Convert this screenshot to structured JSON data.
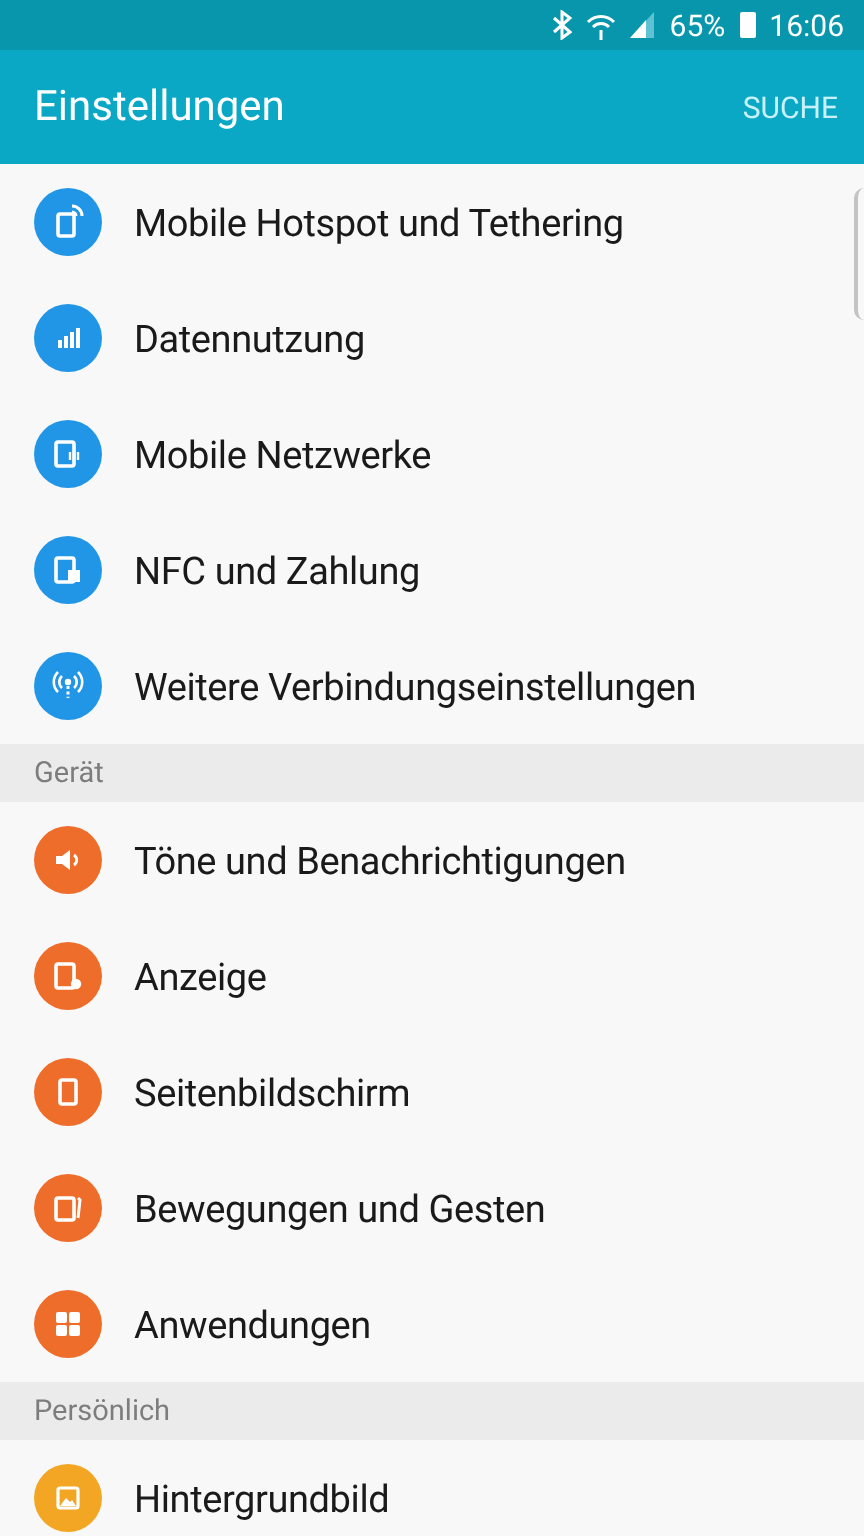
{
  "status_bar": {
    "battery": "65%",
    "time": "16:06"
  },
  "app_bar": {
    "title": "Einstellungen",
    "action": "SUCHE"
  },
  "sections": [
    {
      "items": [
        {
          "label": "Mobile Hotspot und Tethering",
          "color": "#2196e6"
        },
        {
          "label": "Datennutzung",
          "color": "#2196e6"
        },
        {
          "label": "Mobile Netzwerke",
          "color": "#2196e6"
        },
        {
          "label": "NFC und Zahlung",
          "color": "#2196e6"
        },
        {
          "label": "Weitere Verbindungseinstellungen",
          "color": "#2196e6"
        }
      ]
    },
    {
      "header": "Gerät",
      "items": [
        {
          "label": "Töne und Benachrichtigungen",
          "color": "#ee6d2a"
        },
        {
          "label": "Anzeige",
          "color": "#ee6d2a"
        },
        {
          "label": "Seitenbildschirm",
          "color": "#ee6d2a"
        },
        {
          "label": "Bewegungen und Gesten",
          "color": "#ee6d2a"
        },
        {
          "label": "Anwendungen",
          "color": "#ee6d2a"
        }
      ]
    },
    {
      "header": "Persönlich",
      "items": [
        {
          "label": "Hintergrundbild",
          "color": "#f2a623"
        }
      ]
    }
  ]
}
